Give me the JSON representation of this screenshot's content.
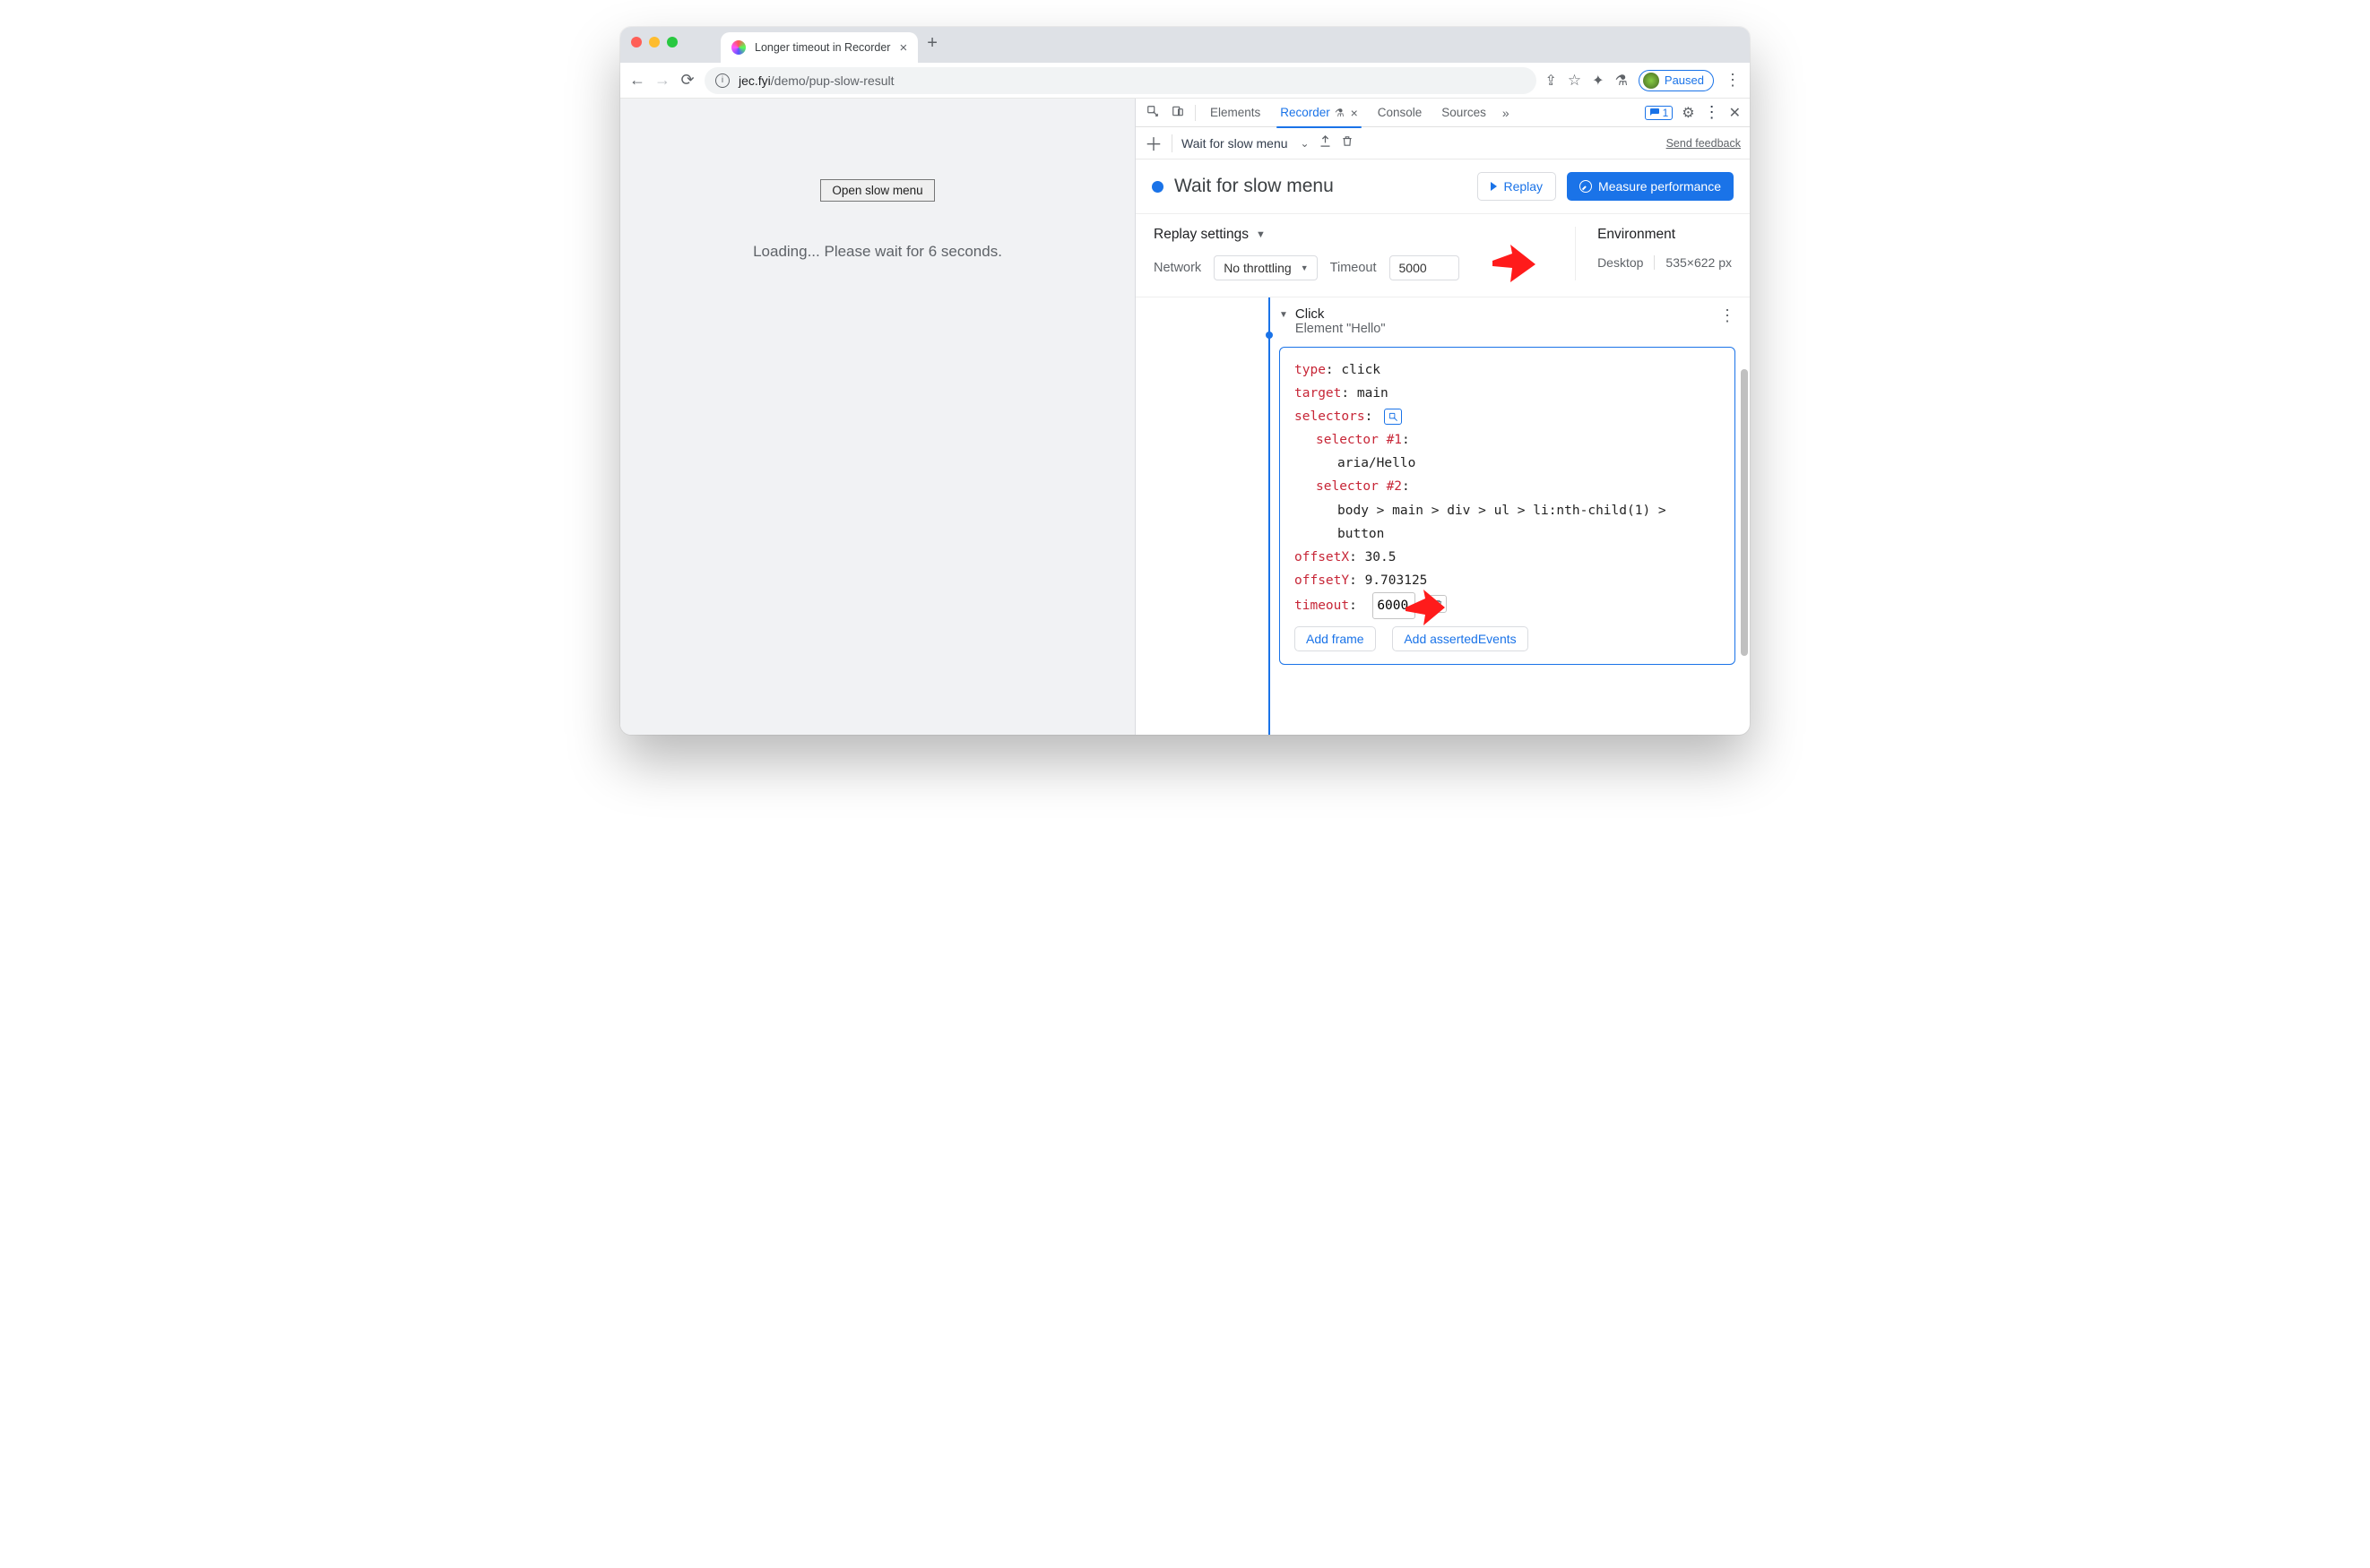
{
  "tab": {
    "title": "Longer timeout in Recorder"
  },
  "url": {
    "domain": "jec.fyi",
    "path": "/demo/pup-slow-result"
  },
  "profile": {
    "label": "Paused"
  },
  "page": {
    "button": "Open slow menu",
    "loading": "Loading... Please wait for 6 seconds."
  },
  "devtools": {
    "tabs": {
      "elements": "Elements",
      "recorder": "Recorder",
      "console": "Console",
      "sources": "Sources"
    },
    "issues_count": "1",
    "toolbar": {
      "recording": "Wait for slow menu",
      "feedback": "Send feedback"
    },
    "header": {
      "title": "Wait for slow menu",
      "replay": "Replay",
      "measure": "Measure performance"
    },
    "settings": {
      "title": "Replay settings",
      "network_label": "Network",
      "network_value": "No throttling",
      "timeout_label": "Timeout",
      "timeout_value": "5000"
    },
    "env": {
      "title": "Environment",
      "device": "Desktop",
      "size": "535×622 px"
    },
    "step": {
      "title": "Click",
      "subtitle": "Element \"Hello\"",
      "type_key": "type",
      "type_val": "click",
      "target_key": "target",
      "target_val": "main",
      "selectors_key": "selectors",
      "sel1_key": "selector #1",
      "sel1_val": "aria/Hello",
      "sel2_key": "selector #2",
      "sel2_val": "body > main > div > ul > li:nth-child(1) > button",
      "offx_key": "offsetX",
      "offx_val": "30.5",
      "offy_key": "offsetY",
      "offy_val": "9.703125",
      "timeout_key": "timeout",
      "timeout_val": "6000",
      "add_frame": "Add frame",
      "add_asserted": "Add assertedEvents"
    }
  }
}
